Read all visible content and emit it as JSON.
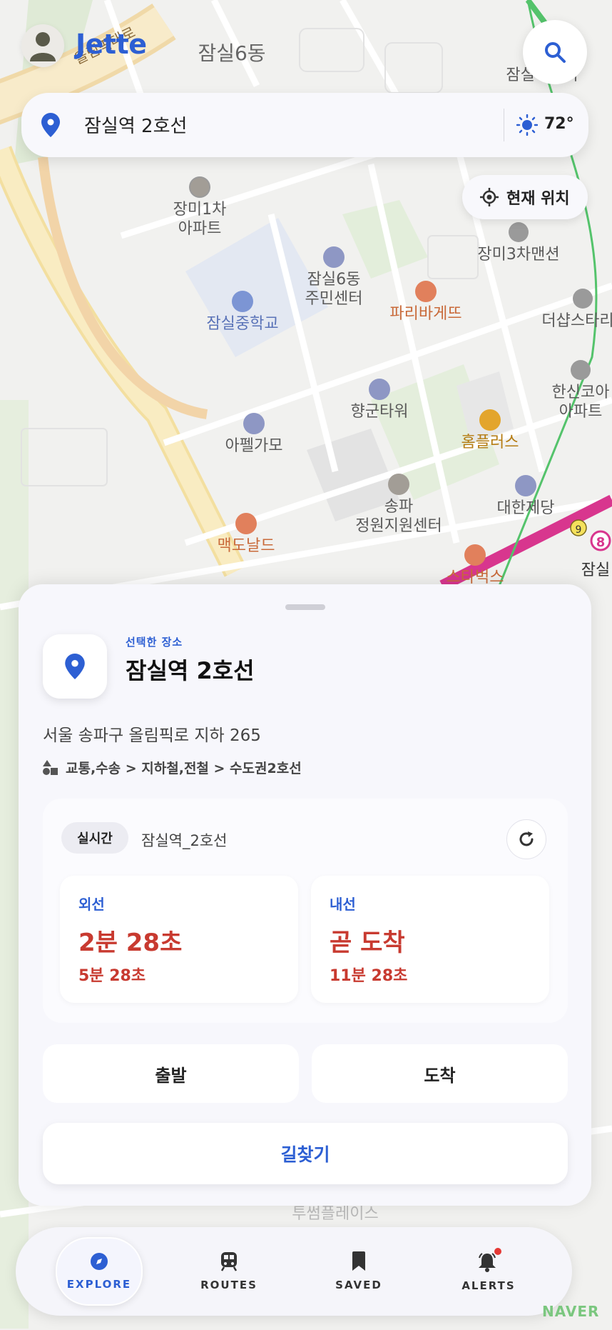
{
  "header": {
    "brand": "Jette"
  },
  "search": {
    "location": "잠실역 2호선",
    "temperature": "72°"
  },
  "locate_button": {
    "label": "현재 위치"
  },
  "map": {
    "labels": {
      "dong": "잠실6동",
      "station_top": "잠실나루역",
      "road": "올림픽대로",
      "jangmi1": "장미1차",
      "apt": "아파트",
      "jangmi3": "장미3차맨션",
      "center1": "잠실6동",
      "center2": "주민센터",
      "paris": "파리바게뜨",
      "school": "잠실중학교",
      "theshop": "더샵스타리",
      "hanshin1": "한신코아",
      "hanshin2": "아파트",
      "hyanggun": "향군타워",
      "apel": "아펠가모",
      "homeplus": "홈플러스",
      "songpa1": "송파",
      "songpa2": "정원지원센터",
      "daehan": "대한제당",
      "mcd": "맥도날드",
      "starbucks": "스타벅스",
      "jamsil": "잠실",
      "line9": "9",
      "line8": "8",
      "twin": "투썸플레이스"
    }
  },
  "sheet": {
    "subtitle": "선택한 장소",
    "title": "잠실역 2호선",
    "address": "서울 송파구 올림픽로 지하 265",
    "category": "교통,수송 > 지하철,전철 > 수도권2호선",
    "realtime": {
      "badge": "실시간",
      "station": "잠실역_2호선",
      "directions": [
        {
          "name": "외선",
          "first": "2분 28초",
          "second": "5분 28초"
        },
        {
          "name": "내선",
          "first": "곧 도착",
          "second": "11분 28초"
        }
      ]
    },
    "depart_label": "출발",
    "arrive_label": "도착",
    "route_label": "길찾기"
  },
  "nav": {
    "items": [
      {
        "label": "EXPLORE",
        "icon": "compass-icon",
        "active": true
      },
      {
        "label": "ROUTES",
        "icon": "train-icon"
      },
      {
        "label": "SAVED",
        "icon": "bookmark-icon"
      },
      {
        "label": "ALERTS",
        "icon": "bell-icon",
        "badge": true
      }
    ]
  },
  "watermark": "NAVER",
  "colors": {
    "accent": "#2d5fd3",
    "arrival": "#c83a30",
    "line2": "#d8368e",
    "alert_dot": "#e53935"
  }
}
